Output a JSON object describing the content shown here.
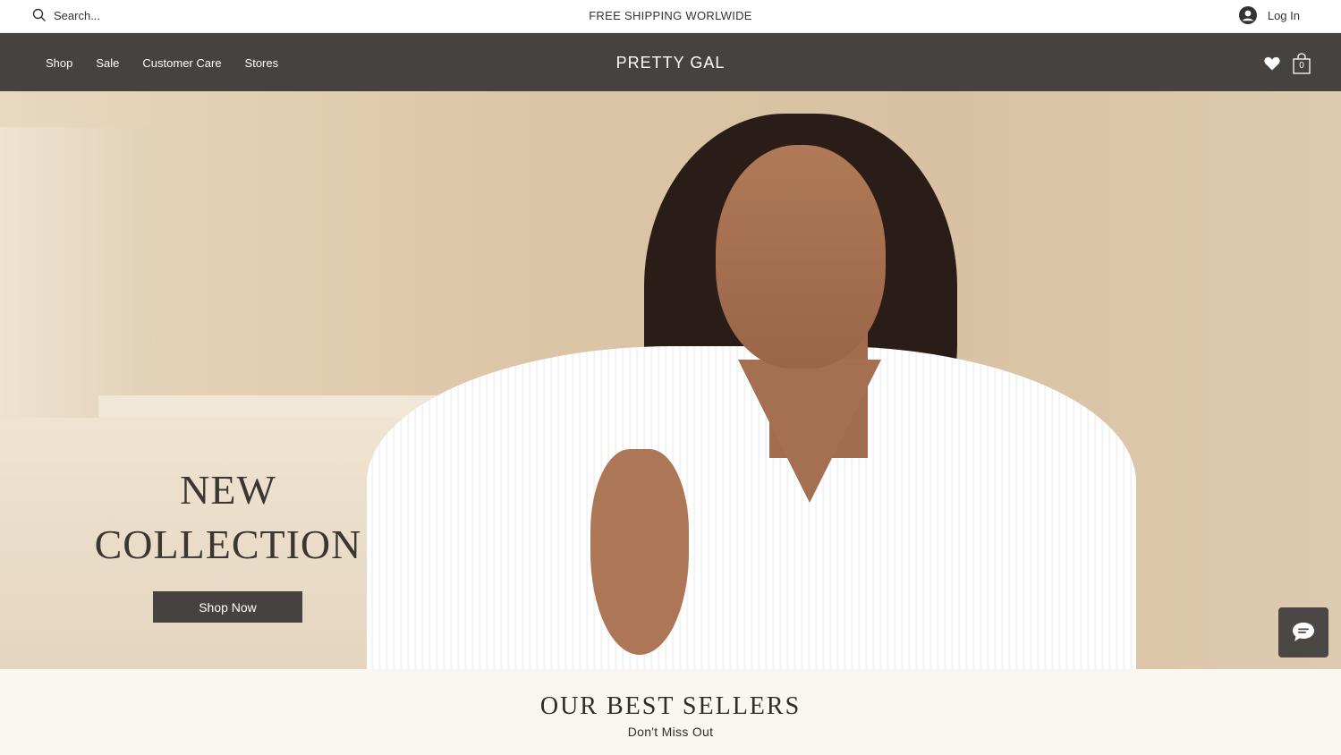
{
  "topbar": {
    "search_placeholder": "Search...",
    "shipping_text": "FREE SHIPPING WORLWIDE",
    "login_label": "Log In"
  },
  "nav": {
    "items": [
      {
        "label": "Shop"
      },
      {
        "label": "Sale"
      },
      {
        "label": "Customer Care"
      },
      {
        "label": "Stores"
      }
    ],
    "brand": "PRETTY GAL",
    "cart_count": "0",
    "icons": [
      "heart-icon",
      "cart-icon"
    ]
  },
  "hero": {
    "heading_line1": "NEW",
    "heading_line2": "COLLECTION",
    "cta_label": "Shop Now"
  },
  "bestsellers": {
    "title": "OUR BEST SELLERS",
    "subtitle": "Don't Miss Out"
  },
  "colors": {
    "nav_bg": "#454240",
    "page_bg": "#faf7f0",
    "hero_bg": "#dcc5a6"
  }
}
